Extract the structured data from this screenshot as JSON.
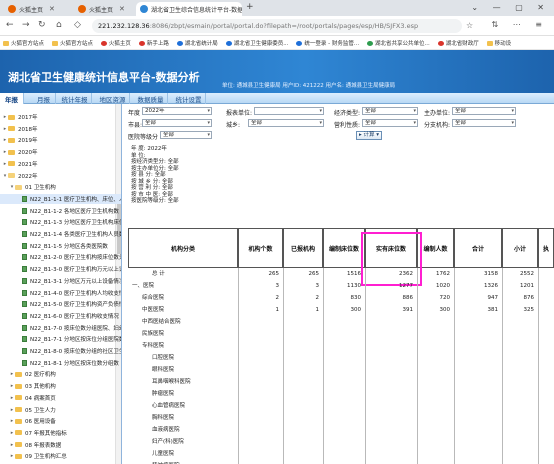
{
  "browser": {
    "tabs": [
      {
        "title": "火狐主页"
      },
      {
        "title": "火狐主页"
      },
      {
        "title": "湖北省卫生综合信息统计平台-数据..."
      }
    ],
    "new_tab": "+",
    "url_host": "221.232.128.36",
    "url_path": ":8086/zbpt/esmain/portal/portal.do?filepath=/root/portals/pages/esp/HB/SJFX3.esp",
    "bookmarks": [
      "火狐官方站点",
      "火狐官方站点",
      "火狐主页",
      "新手上路",
      "湖北省统计局",
      "湖北省卫生健康委员...",
      "统一登录 - 财务监管...",
      "湖北省共享公共单位...",
      "湖北省财政厅",
      "移动设"
    ]
  },
  "app": {
    "title": "湖北省卫生健康统计信息平台-数据分析",
    "user_info": "单位: 通城县卫生健康局  用户ID: 421222  用户名: 通城县卫生局健康局"
  },
  "nav": {
    "tabs": [
      "年报",
      "月报",
      "统计年报",
      "地区资源",
      "数据质量",
      "统计设置"
    ]
  },
  "sidebar": {
    "items": [
      {
        "label": "2017年",
        "indent": 0,
        "type": "folder",
        "expanded": false
      },
      {
        "label": "2018年",
        "indent": 0,
        "type": "folder",
        "expanded": false
      },
      {
        "label": "2019年",
        "indent": 0,
        "type": "folder",
        "expanded": false
      },
      {
        "label": "2020年",
        "indent": 0,
        "type": "folder",
        "expanded": false
      },
      {
        "label": "2021年",
        "indent": 0,
        "type": "folder",
        "expanded": false
      },
      {
        "label": "2022年",
        "indent": 0,
        "type": "folder",
        "expanded": true
      },
      {
        "label": "01 卫生机构",
        "indent": 1,
        "type": "folder",
        "expanded": true
      },
      {
        "label": "N22_B1-1-1 医疗卫生机构、床位、人...",
        "indent": 2,
        "type": "doc",
        "selected": true
      },
      {
        "label": "N22_B1-1-2 各地区医疗卫生机构数",
        "indent": 2,
        "type": "doc"
      },
      {
        "label": "N22_B1-1-3 分地区医疗卫生机构床位",
        "indent": 2,
        "type": "doc"
      },
      {
        "label": "N22_B1-1-4 各类医疗卫生机构人员数",
        "indent": 2,
        "type": "doc"
      },
      {
        "label": "N22_B1-1-5 分地区各类医院数",
        "indent": 2,
        "type": "doc"
      },
      {
        "label": "N22_B1-2-0 医疗卫生机构按床位数分组",
        "indent": 2,
        "type": "doc"
      },
      {
        "label": "N22_B1-3-0 医疗卫生机构万元以上设备",
        "indent": 2,
        "type": "doc"
      },
      {
        "label": "N22_B1-3-1 分地区万元以上设备情况",
        "indent": 2,
        "type": "doc"
      },
      {
        "label": "N22_B1-4-0 医疗卫生机构人均收支情况",
        "indent": 2,
        "type": "doc"
      },
      {
        "label": "N22_B1-5-0 医疗卫生机构资产负债情况",
        "indent": 2,
        "type": "doc"
      },
      {
        "label": "N22_B1-6-0 医疗卫生机构收支情况",
        "indent": 2,
        "type": "doc"
      },
      {
        "label": "N22_B1-7-0 按床位数分组医院、妇幼...",
        "indent": 2,
        "type": "doc"
      },
      {
        "label": "N22_B1-7-1 分地区按床位分组医院数",
        "indent": 2,
        "type": "doc"
      },
      {
        "label": "N22_B1-8-0 按床位数分组的社区卫生...",
        "indent": 2,
        "type": "doc"
      },
      {
        "label": "N22_B1-8-1 分地区按床位数分组数",
        "indent": 2,
        "type": "doc"
      },
      {
        "label": "02 医疗机构",
        "indent": 1,
        "type": "folder",
        "expanded": false
      },
      {
        "label": "03 其他机构",
        "indent": 1,
        "type": "folder",
        "expanded": false
      },
      {
        "label": "04 病案首页",
        "indent": 1,
        "type": "folder",
        "expanded": false
      },
      {
        "label": "05 卫生人力",
        "indent": 1,
        "type": "folder",
        "expanded": false
      },
      {
        "label": "06 医用设备",
        "indent": 1,
        "type": "folder",
        "expanded": false
      },
      {
        "label": "07 年报其他指标",
        "indent": 1,
        "type": "folder",
        "expanded": false
      },
      {
        "label": "08 年报表数据",
        "indent": 1,
        "type": "folder",
        "expanded": false
      },
      {
        "label": "09 卫生机构汇总",
        "indent": 1,
        "type": "folder",
        "expanded": false
      }
    ]
  },
  "filters": {
    "year_label": "年度",
    "year_value": "2022年",
    "unit_label": "报表单位:",
    "unit_value": "",
    "econ_label": "经济类型:",
    "econ_value": "全部",
    "agency_label": "主办单位:",
    "agency_value": "全部",
    "city_label": "市县:",
    "city_value": "全部",
    "town_label": "城乡:",
    "town_value": "全部",
    "profit_label": "营利性质:",
    "profit_value": "全部",
    "branch_label": "分支机构:",
    "branch_value": "全部",
    "level_label": "医院等级分",
    "level_value": "全部",
    "calc_button": "计算"
  },
  "info_lines": [
    "年    度: 2022年",
    "单    位:",
    "按经济类型分: 全部",
    "按主办单位分: 全部",
    "按    县    分: 全部",
    "按    城    乡    分: 全部",
    "按    营    利    分: 全部",
    "按    市    中    医: 全部",
    "按医院等级分: 全部"
  ],
  "table": {
    "headers": {
      "category": "机构分类",
      "count": "机构个数",
      "approved": "已报机构",
      "planned_beds": "编制床位数",
      "actual_beds": "实有床位数",
      "staff_plan": "编制人数",
      "total": "合计",
      "subtotal": "小计",
      "extra": "执"
    },
    "rows": [
      {
        "label": "总    计",
        "values": [
          "265",
          "265",
          "1516",
          "2362",
          "1762",
          "3158",
          "2552"
        ],
        "indent": 2
      },
      {
        "label": "一、医院",
        "values": [
          "3",
          "3",
          "1130",
          "1277",
          "1020",
          "1326",
          "1201"
        ],
        "indent": 0
      },
      {
        "label": "综合医院",
        "values": [
          "2",
          "2",
          "830",
          "886",
          "720",
          "947",
          "876"
        ],
        "indent": 1
      },
      {
        "label": "中医医院",
        "values": [
          "1",
          "1",
          "300",
          "391",
          "300",
          "381",
          "325"
        ],
        "indent": 1
      },
      {
        "label": "中西医结合医院",
        "values": [
          "",
          "",
          "",
          "",
          "",
          "",
          ""
        ],
        "indent": 1
      },
      {
        "label": "民族医院",
        "values": [
          "",
          "",
          "",
          "",
          "",
          "",
          ""
        ],
        "indent": 1
      },
      {
        "label": "专科医院",
        "values": [
          "",
          "",
          "",
          "",
          "",
          "",
          ""
        ],
        "indent": 1
      },
      {
        "label": "口腔医院",
        "values": [
          "",
          "",
          "",
          "",
          "",
          "",
          ""
        ],
        "indent": 2
      },
      {
        "label": "眼科医院",
        "values": [
          "",
          "",
          "",
          "",
          "",
          "",
          ""
        ],
        "indent": 2
      },
      {
        "label": "耳鼻咽喉科医院",
        "values": [
          "",
          "",
          "",
          "",
          "",
          "",
          ""
        ],
        "indent": 2
      },
      {
        "label": "肿瘤医院",
        "values": [
          "",
          "",
          "",
          "",
          "",
          "",
          ""
        ],
        "indent": 2
      },
      {
        "label": "心血管病医院",
        "values": [
          "",
          "",
          "",
          "",
          "",
          "",
          ""
        ],
        "indent": 2
      },
      {
        "label": "胸科医院",
        "values": [
          "",
          "",
          "",
          "",
          "",
          "",
          ""
        ],
        "indent": 2
      },
      {
        "label": "血液病医院",
        "values": [
          "",
          "",
          "",
          "",
          "",
          "",
          ""
        ],
        "indent": 2
      },
      {
        "label": "妇产(科)医院",
        "values": [
          "",
          "",
          "",
          "",
          "",
          "",
          ""
        ],
        "indent": 2
      },
      {
        "label": "儿童医院",
        "values": [
          "",
          "",
          "",
          "",
          "",
          "",
          ""
        ],
        "indent": 2
      },
      {
        "label": "精神病医院",
        "values": [
          "",
          "",
          "",
          "",
          "",
          "",
          ""
        ],
        "indent": 2
      }
    ]
  },
  "colors": {
    "header_blue": "#2f86d4",
    "highlight": "#ff1fd1",
    "selected_row": "#dbe9fb"
  }
}
